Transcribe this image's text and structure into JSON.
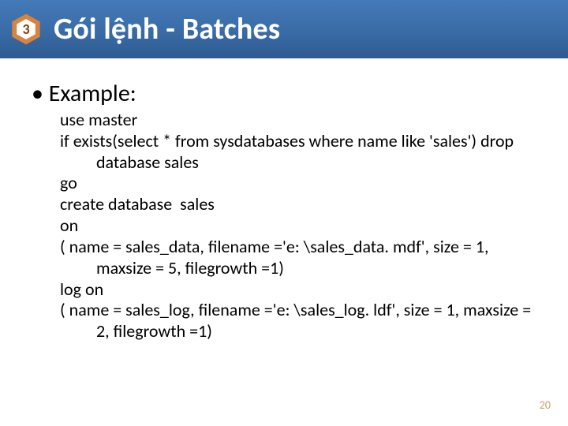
{
  "header": {
    "badge_number": "3",
    "title": "Gói lệnh - Batches"
  },
  "content": {
    "bullet_label": "Example:",
    "code_lines": [
      "use master",
      "if exists(select * from sysdatabases where name like 'sales') drop database sales",
      "go",
      "create database  sales",
      "on",
      "( name = sales_data, filename ='e: \\sales_data. mdf', size = 1, maxsize = 5, filegrowth =1)",
      "log on",
      "( name = sales_log, filename ='e: \\sales_log. ldf', size = 1, maxsize = 2, filegrowth =1)"
    ]
  },
  "page_number": "20"
}
